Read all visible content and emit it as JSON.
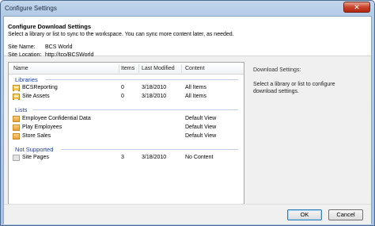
{
  "window": {
    "title": "Configure Settings",
    "close_glyph": "✕"
  },
  "header": {
    "title": "Configure Download Settings",
    "description": "Select a library or list to sync to the workspace.  You can sync more content later, as needed.",
    "site_name_label": "Site Name:",
    "site_name_value": "BCS World",
    "site_location_label": "Site Location:",
    "site_location_value": "http://tco/BCSWorld"
  },
  "table": {
    "columns": [
      "Name",
      "Items",
      "Last Modified",
      "Content"
    ],
    "groups": [
      {
        "label": "Libraries",
        "icon": "library-icon",
        "rows": [
          {
            "name": "BCSReporting",
            "items": "0",
            "modified": "3/18/2010",
            "content": "All Items"
          },
          {
            "name": "Site Assets",
            "items": "0",
            "modified": "3/18/2010",
            "content": "All Items"
          }
        ]
      },
      {
        "label": "Lists",
        "icon": "list-icon",
        "rows": [
          {
            "name": "Employee Confidential Data",
            "items": "",
            "modified": "",
            "content": "Default View"
          },
          {
            "name": "Play Employees",
            "items": "",
            "modified": "",
            "content": "Default View"
          },
          {
            "name": "Store Sales",
            "items": "",
            "modified": "",
            "content": "Default View"
          }
        ]
      },
      {
        "label": "Not Supported",
        "icon": "unsupported-list-icon",
        "rows": [
          {
            "name": "Site Pages",
            "items": "3",
            "modified": "3/18/2010",
            "content": "No Content"
          }
        ]
      }
    ]
  },
  "details": {
    "title": "Download Settings:",
    "text": "Select a library or list to configure download settings."
  },
  "buttons": {
    "ok": "OK",
    "cancel": "Cancel"
  }
}
